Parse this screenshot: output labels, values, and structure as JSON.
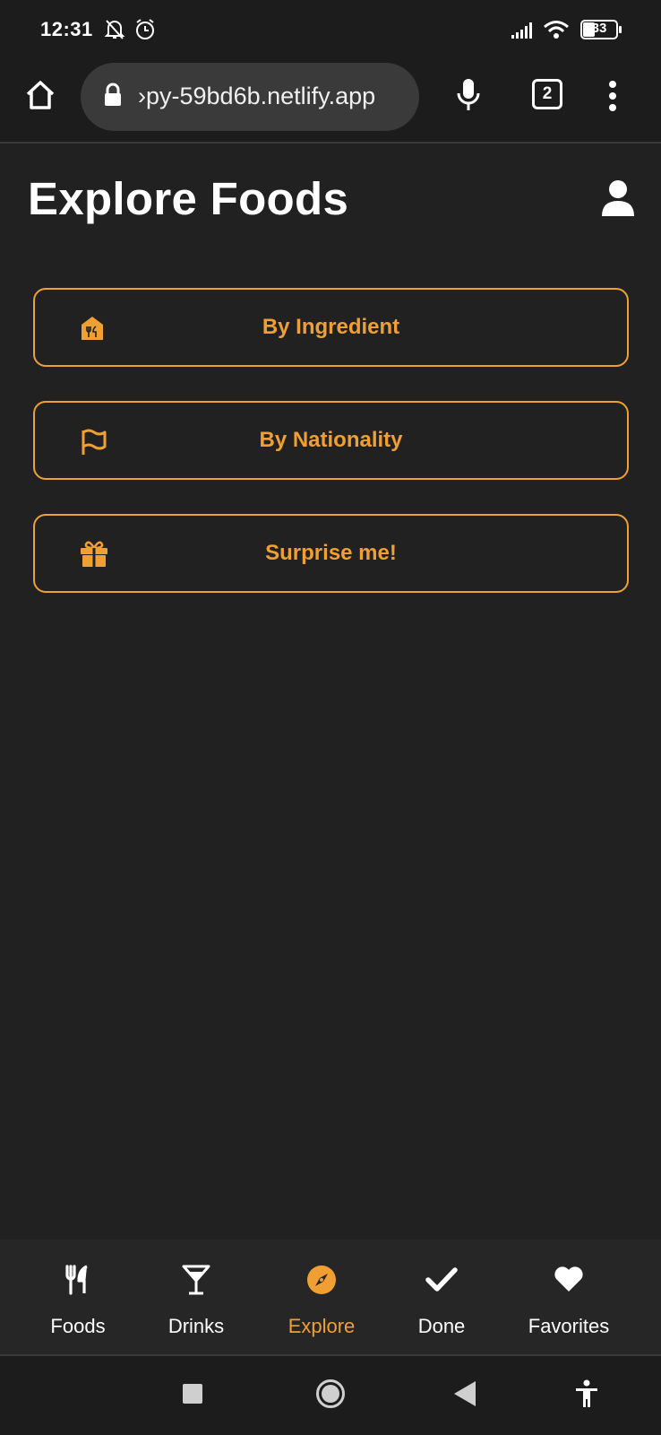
{
  "status_bar": {
    "time": "12:31",
    "battery": "33",
    "icons": [
      "bell-off-icon",
      "alarm-icon",
      "signal-icon",
      "wifi-icon",
      "battery-icon"
    ]
  },
  "browser": {
    "url": "›py-59bd6b.netlify.app",
    "tab_count": "2",
    "icons": [
      "home-icon",
      "lock-icon",
      "mic-icon",
      "tabs-icon",
      "more-vert-icon"
    ]
  },
  "page": {
    "title": "Explore Foods",
    "profile_icon": "user-icon"
  },
  "options": [
    {
      "label": "By Ingredient",
      "icon": "ingredient-house-icon"
    },
    {
      "label": "By Nationality",
      "icon": "flag-icon"
    },
    {
      "label": "Surprise me!",
      "icon": "gift-icon"
    }
  ],
  "bottom_nav": {
    "active": "Explore",
    "items": [
      {
        "label": "Foods",
        "icon": "utensils-icon"
      },
      {
        "label": "Drinks",
        "icon": "cocktail-icon"
      },
      {
        "label": "Explore",
        "icon": "compass-icon"
      },
      {
        "label": "Done",
        "icon": "check-icon"
      },
      {
        "label": "Favorites",
        "icon": "heart-icon"
      }
    ]
  },
  "colors": {
    "background": "#212121",
    "accent": "#f0a032",
    "text": "#ffffff"
  }
}
